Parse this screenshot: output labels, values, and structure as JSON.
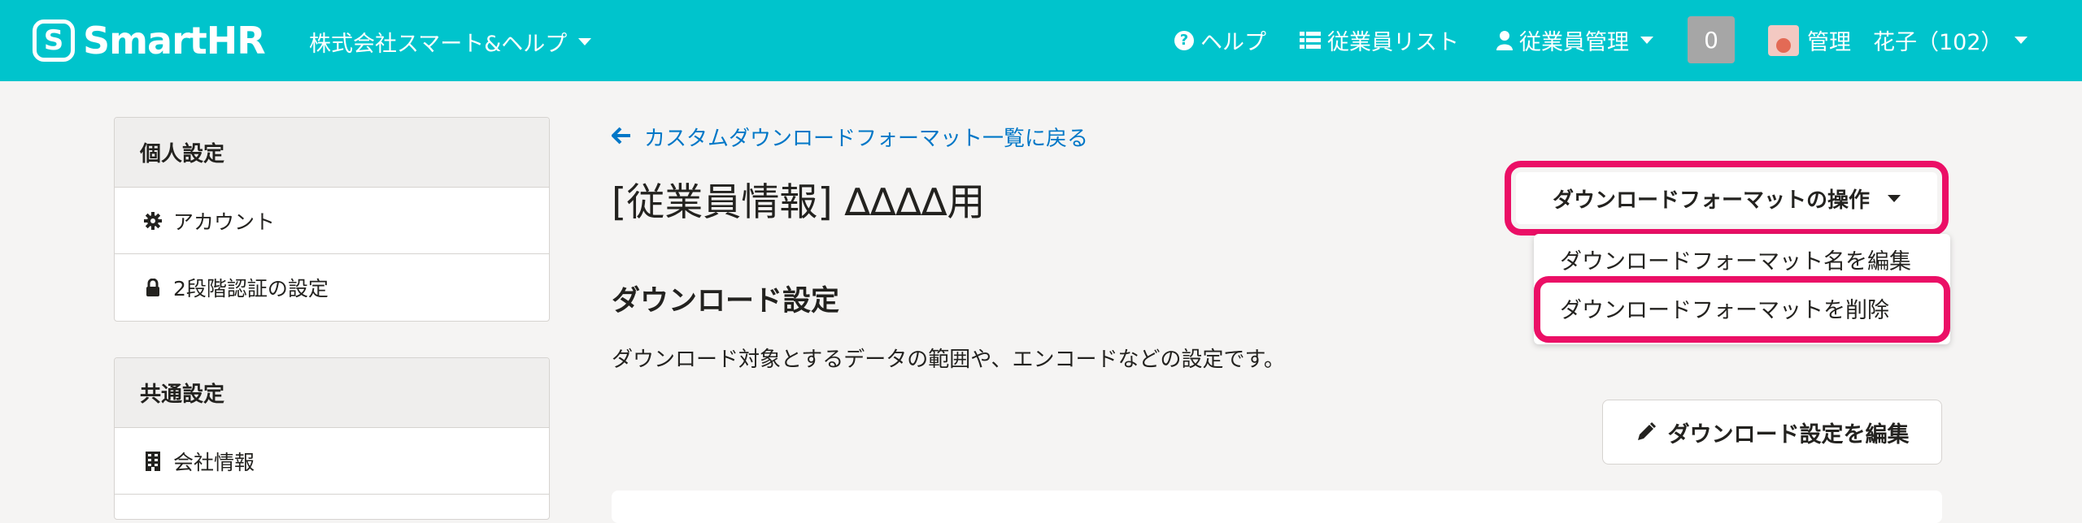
{
  "header": {
    "logo_mark": "S",
    "logo_text": "SmartHR",
    "company_name": "株式会社スマート&ヘルプ",
    "nav": {
      "help": "ヘルプ",
      "employee_list": "従業員リスト",
      "employee_management": "従業員管理"
    },
    "notification_count": "0",
    "user_name": "管理　花子（102）",
    "colors": {
      "bar": "#00c4cc"
    }
  },
  "sidebar": {
    "personal": {
      "heading": "個人設定",
      "items": [
        {
          "label": "アカウント",
          "icon": "gear-icon"
        },
        {
          "label": "2段階認証の設定",
          "icon": "lock-icon"
        }
      ]
    },
    "common": {
      "heading": "共通設定",
      "items": [
        {
          "label": "会社情報",
          "icon": "building-icon"
        }
      ]
    }
  },
  "main": {
    "back_link": "カスタムダウンロードフォーマット一覧に戻る",
    "title": "[従業員情報] ∆∆∆∆用",
    "operations_button": "ダウンロードフォーマットの操作",
    "dropdown": {
      "items": [
        "ダウンロードフォーマット名を編集",
        "ダウンロードフォーマットを削除"
      ]
    },
    "section_title": "ダウンロード設定",
    "section_desc": "ダウンロード対象とするデータの範囲や、エンコードなどの設定です。",
    "edit_button": "ダウンロード設定を編集",
    "colors": {
      "link": "#0077c7",
      "highlight": "#eb0f66"
    }
  }
}
